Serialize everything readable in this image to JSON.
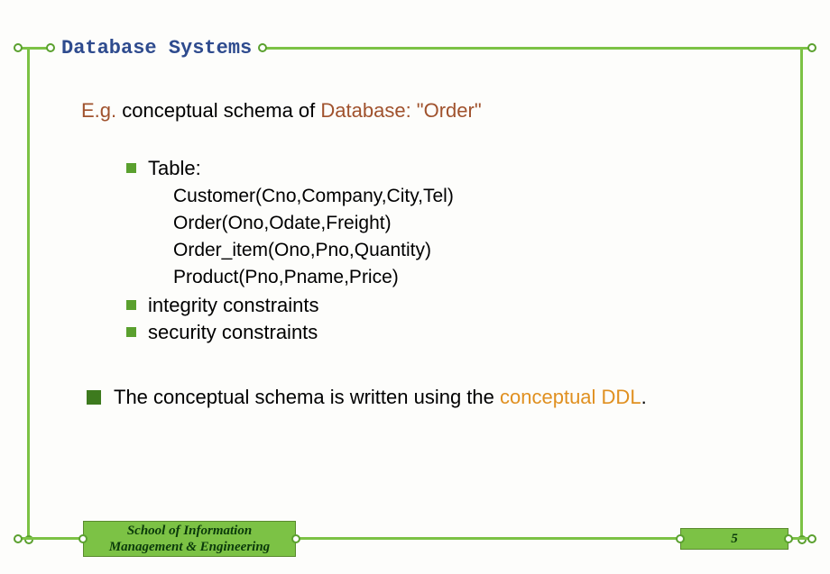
{
  "title": "Database Systems",
  "heading": {
    "prefix": "E.g.",
    "mid": " conceptual schema of ",
    "dbname": "Database: \"Order\""
  },
  "bullets": {
    "table_label": "Table:",
    "tables": [
      "Customer(Cno,Company,City,Tel)",
      "Order(Ono,Odate,Freight)",
      "Order_item(Ono,Pno,Quantity)",
      "Product(Pno,Pname,Price)"
    ],
    "integrity": "integrity constraints",
    "security": "security constraints"
  },
  "main_bullet": {
    "prefix": "The conceptual schema is written using the ",
    "highlight": "conceptual DDL",
    "suffix": "."
  },
  "footer": {
    "school_line1": "School of Information",
    "school_line2": "Management & Engineering",
    "page": "5"
  }
}
